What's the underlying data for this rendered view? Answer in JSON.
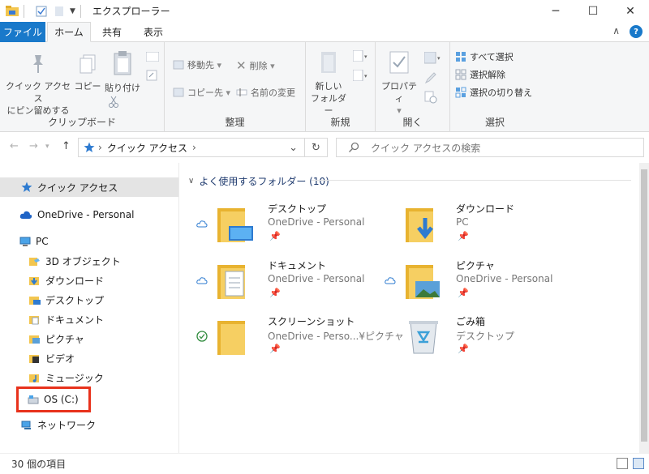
{
  "window": {
    "title": "エクスプローラー",
    "minimize": "─",
    "maximize": "☐",
    "close": "✕"
  },
  "ribbon_tabs": {
    "file": "ファイル",
    "home": "ホーム",
    "share": "共有",
    "view": "表示"
  },
  "ribbon": {
    "clipboard": {
      "label": "クリップボード",
      "pin_line1": "クイック アクセス",
      "pin_line2": "にピン留めする",
      "copy": "コピー",
      "paste": "貼り付け"
    },
    "organize": {
      "label": "整理",
      "move_to": "移動先",
      "copy_to": "コピー先",
      "delete": "削除",
      "rename": "名前の変更"
    },
    "new": {
      "label": "新規",
      "new_folder_line1": "新しい",
      "new_folder_line2": "フォルダー"
    },
    "open": {
      "label": "開く",
      "properties": "プロパティ"
    },
    "select": {
      "label": "選択",
      "select_all": "すべて選択",
      "select_none": "選択解除",
      "invert": "選択の切り替え"
    }
  },
  "nav": {
    "back": "←",
    "forward": "→",
    "up": "↑",
    "address": "クイック アクセス",
    "address_chevron": "›",
    "dropdown": "⌄",
    "refresh": "↻",
    "search_placeholder": "クイック アクセスの検索"
  },
  "sidebar": {
    "items": [
      {
        "label": "クイック アクセス",
        "icon": "star-icon"
      },
      {
        "label": "OneDrive - Personal",
        "icon": "cloud-icon"
      },
      {
        "label": "PC",
        "icon": "pc-icon"
      },
      {
        "label": "3D オブジェクト",
        "icon": "3d-objects-icon"
      },
      {
        "label": "ダウンロード",
        "icon": "downloads-icon"
      },
      {
        "label": "デスクトップ",
        "icon": "desktop-icon"
      },
      {
        "label": "ドキュメント",
        "icon": "documents-icon"
      },
      {
        "label": "ピクチャ",
        "icon": "pictures-icon"
      },
      {
        "label": "ビデオ",
        "icon": "videos-icon"
      },
      {
        "label": "ミュージック",
        "icon": "music-icon"
      },
      {
        "label": "OS (C:)",
        "icon": "drive-icon"
      },
      {
        "label": "ネットワーク",
        "icon": "network-icon"
      }
    ]
  },
  "content": {
    "section_title": "よく使用するフォルダー (10)",
    "tiles": [
      {
        "name": "デスクトップ",
        "sub": "OneDrive - Personal",
        "status": "cloud-status-icon"
      },
      {
        "name": "ダウンロード",
        "sub": "PC",
        "status": ""
      },
      {
        "name": "ドキュメント",
        "sub": "OneDrive - Personal",
        "status": "cloud-status-icon"
      },
      {
        "name": "ピクチャ",
        "sub": "OneDrive - Personal",
        "status": "cloud-status-icon"
      },
      {
        "name": "スクリーンショット",
        "sub": "OneDrive - Perso...¥ピクチャ",
        "status": "synced-status-icon"
      },
      {
        "name": "ごみ箱",
        "sub": "デスクトップ",
        "status": ""
      }
    ]
  },
  "statusbar": {
    "count": "30 個の項目"
  },
  "colors": {
    "accent": "#1979ca",
    "highlight_box": "#e8321c",
    "folder": "#f3c64f"
  }
}
